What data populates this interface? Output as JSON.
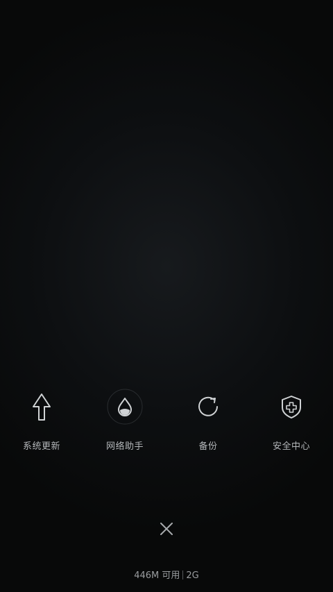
{
  "shortcuts": [
    {
      "label": "系统更新",
      "icon": "arrow-up-icon"
    },
    {
      "label": "网络助手",
      "icon": "water-drop-icon"
    },
    {
      "label": "备份",
      "icon": "refresh-circle-icon"
    },
    {
      "label": "安全中心",
      "icon": "shield-plus-icon"
    }
  ],
  "close": {
    "icon": "close-icon"
  },
  "memory": {
    "available": "446M 可用",
    "total": "2G"
  },
  "colors": {
    "background": "#0d0f11",
    "icon_stroke": "#c9ccce",
    "label": "#b4b7ba"
  }
}
